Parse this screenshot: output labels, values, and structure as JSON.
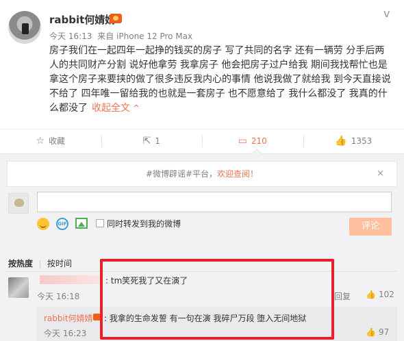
{
  "post": {
    "username": "rabbit何婧婧",
    "time": "今天 16:13",
    "source": "来自 iPhone 12 Pro Max",
    "text_lines": [
      "房子我们在一起四年一起挣的钱买的房子 写了共同的名字 还有一辆劳 分手后两",
      "人的共同财产分割 说好他拿劳 我拿房子 他会把房子过户给我 期间我找帮忙也是",
      "拿这个房子来要挟的做了很多违反我内心的事情 他说我做了就给我 到今天直接说",
      "不给了 四年唯一留给我的也就是一套房子 也不愿意给了 我什么都没了 我真的什",
      "么都没了"
    ],
    "collapse_label": "收起全文",
    "collapse_arrow": "^",
    "chevron": "v"
  },
  "actions": [
    {
      "icon": "☆",
      "label": "收藏"
    },
    {
      "icon": "⇱",
      "label": "1"
    },
    {
      "icon": "▭",
      "label": "210"
    },
    {
      "icon": "👍",
      "label": "1353"
    }
  ],
  "notice": {
    "text": "#微博辟谣#平台，",
    "link": "欢迎查阅！",
    "close": "×"
  },
  "composer": {
    "input_value": "",
    "repost_label": "同时转发到我的微博",
    "submit_label": "评论",
    "gif_label": "GIF"
  },
  "sort": {
    "tabs": [
      "按热度",
      "按时间"
    ]
  },
  "comments": [
    {
      "text": ": tm笑死我了又在演了",
      "time": "今天 16:18",
      "reply_label": "回复",
      "likes": "102"
    }
  ],
  "sub_comment": {
    "username": "rabbit何婧婧",
    "text": ": 我拿的生命发誓 有一句在演 我碎尸万段 堕入无间地狱",
    "time": "今天 16:23",
    "likes": "97"
  },
  "colors": {
    "accent": "#eb7350",
    "highlight": "#e8202a",
    "background": "#f2f2f5"
  }
}
